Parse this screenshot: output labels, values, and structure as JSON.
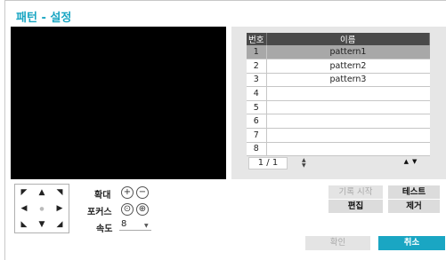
{
  "title": "패턴 - 설정",
  "table": {
    "headers": [
      "번호",
      "이름"
    ],
    "rows": [
      {
        "no": "1",
        "name": "pattern1"
      },
      {
        "no": "2",
        "name": "pattern2"
      },
      {
        "no": "3",
        "name": "pattern3"
      },
      {
        "no": "4",
        "name": ""
      },
      {
        "no": "5",
        "name": ""
      },
      {
        "no": "6",
        "name": ""
      },
      {
        "no": "7",
        "name": ""
      },
      {
        "no": "8",
        "name": ""
      }
    ],
    "selected_row": 1
  },
  "pager": {
    "text": "1 / 1"
  },
  "controls": {
    "zoom_label": "확대",
    "focus_label": "포커스",
    "speed_label": "속도",
    "speed_value": "8"
  },
  "buttons": {
    "record_start": "기록 시작",
    "test": "테스트",
    "edit": "편집",
    "remove": "제거",
    "ok": "확인",
    "cancel": "취소"
  },
  "colors": {
    "accent": "#1aa6c3",
    "table_header": "#4a4a4a",
    "selected_row": "#a8a8a8"
  }
}
